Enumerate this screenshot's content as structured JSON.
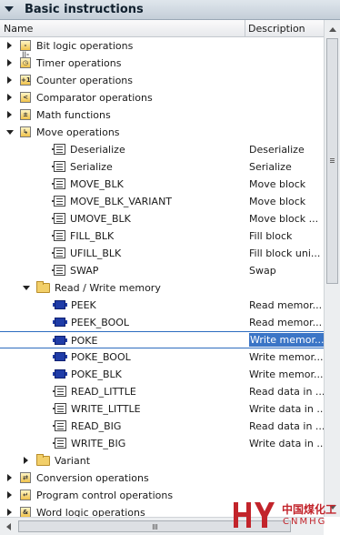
{
  "panel": {
    "title": "Basic instructions"
  },
  "columns": {
    "name": "Name",
    "description": "Description"
  },
  "tree": [
    {
      "label": "Bit logic operations",
      "desc": "",
      "expander": "closed",
      "icon": "bit-logic-icon",
      "glyph": "-||-",
      "depth": 0
    },
    {
      "label": "Timer operations",
      "desc": "",
      "expander": "closed",
      "icon": "timer-icon",
      "glyph": "◷",
      "depth": 0
    },
    {
      "label": "Counter operations",
      "desc": "",
      "expander": "closed",
      "icon": "counter-icon",
      "glyph": "+1",
      "depth": 0
    },
    {
      "label": "Comparator operations",
      "desc": "",
      "expander": "closed",
      "icon": "comparator-icon",
      "glyph": "<",
      "depth": 0
    },
    {
      "label": "Math functions",
      "desc": "",
      "expander": "closed",
      "icon": "math-icon",
      "glyph": "±",
      "depth": 0
    },
    {
      "label": "Move operations",
      "desc": "",
      "expander": "open",
      "icon": "move-icon",
      "glyph": "↳",
      "depth": 0
    },
    {
      "label": "Deserialize",
      "desc": "Deserialize",
      "icon": "block-icon",
      "depth": 1
    },
    {
      "label": "Serialize",
      "desc": "Serialize",
      "icon": "block-icon",
      "depth": 1
    },
    {
      "label": "MOVE_BLK",
      "desc": "Move block",
      "icon": "block-icon",
      "depth": 1
    },
    {
      "label": "MOVE_BLK_VARIANT",
      "desc": "Move block",
      "icon": "block-icon",
      "depth": 1
    },
    {
      "label": "UMOVE_BLK",
      "desc": "Move block ...",
      "icon": "block-icon",
      "depth": 1
    },
    {
      "label": "FILL_BLK",
      "desc": "Fill block",
      "icon": "block-icon",
      "depth": 1
    },
    {
      "label": "UFILL_BLK",
      "desc": "Fill block uni...",
      "icon": "block-icon",
      "depth": 1
    },
    {
      "label": "SWAP",
      "desc": "Swap",
      "icon": "block-icon",
      "depth": 1
    },
    {
      "label": "Read / Write memory",
      "desc": "",
      "expander": "open",
      "icon": "folder-icon",
      "depth": 1
    },
    {
      "label": "PEEK",
      "desc": "Read memor...",
      "icon": "memory-icon",
      "depth": 2
    },
    {
      "label": "PEEK_BOOL",
      "desc": "Read memor...",
      "icon": "memory-icon",
      "depth": 2
    },
    {
      "label": "POKE",
      "desc": "Write memor...",
      "icon": "memory-icon",
      "depth": 2,
      "selected": true
    },
    {
      "label": "POKE_BOOL",
      "desc": "Write memor...",
      "icon": "memory-icon",
      "depth": 2
    },
    {
      "label": "POKE_BLK",
      "desc": "Write memor...",
      "icon": "memory-icon",
      "depth": 2
    },
    {
      "label": "READ_LITTLE",
      "desc": "Read data in ...",
      "icon": "block-icon",
      "depth": 2
    },
    {
      "label": "WRITE_LITTLE",
      "desc": "Write data in ...",
      "icon": "block-icon",
      "depth": 2
    },
    {
      "label": "READ_BIG",
      "desc": "Read data in ...",
      "icon": "block-icon",
      "depth": 2
    },
    {
      "label": "WRITE_BIG",
      "desc": "Write data in ...",
      "icon": "block-icon",
      "depth": 2
    },
    {
      "label": "Variant",
      "desc": "",
      "expander": "closed",
      "icon": "folder-icon",
      "depth": 1
    },
    {
      "label": "Conversion operations",
      "desc": "",
      "expander": "closed",
      "icon": "conversion-icon",
      "glyph": "⇄",
      "depth": 0
    },
    {
      "label": "Program control operations",
      "desc": "",
      "expander": "closed",
      "icon": "program-control-icon",
      "glyph": "↵",
      "depth": 0
    },
    {
      "label": "Word logic operations",
      "desc": "",
      "expander": "closed",
      "icon": "word-logic-icon",
      "glyph": "&",
      "depth": 0
    }
  ],
  "watermark": {
    "cn": "中国煤化工",
    "en": "CNMHG"
  },
  "colors": {
    "selection": "#3b75c6",
    "header": "#c4ced8",
    "watermark": "#c2242b"
  }
}
